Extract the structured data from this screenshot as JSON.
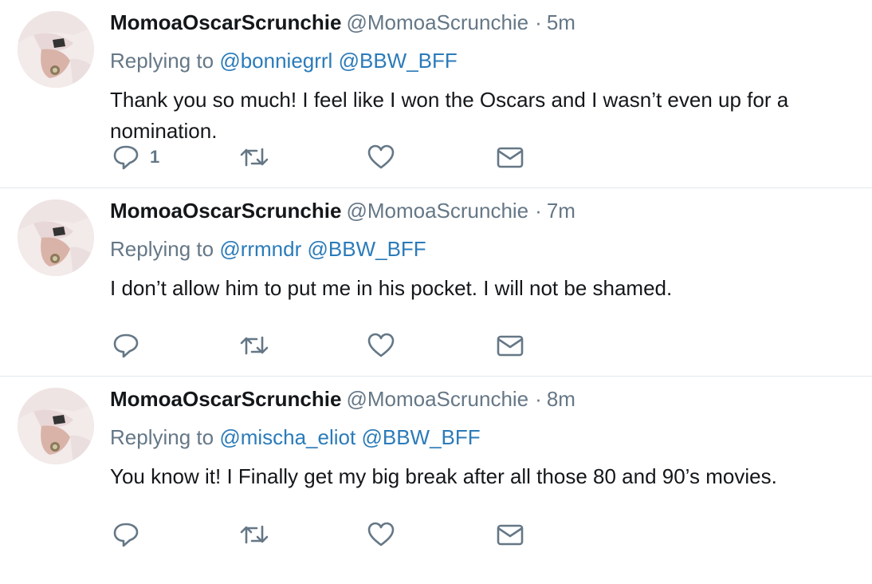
{
  "colors": {
    "link": "#2b7bb9",
    "muted": "#657786",
    "text": "#14171a",
    "divider": "#e1e8ed"
  },
  "tweets": [
    {
      "name": "MomoaOscarScrunchie",
      "handle": "@MomoaScrunchie",
      "separator": "·",
      "time": "5m",
      "replying_prefix": "Replying to",
      "mentions": [
        "@bonniegrrl",
        "@BBW_BFF"
      ],
      "text": "Thank you so much! I feel like I won the Oscars and I wasn’t even up for a nomination.",
      "reply_count": "1",
      "icons": [
        "reply-icon",
        "retweet-icon",
        "like-icon",
        "direct-message-icon"
      ]
    },
    {
      "name": "MomoaOscarScrunchie",
      "handle": "@MomoaScrunchie",
      "separator": "·",
      "time": "7m",
      "replying_prefix": "Replying to",
      "mentions": [
        "@rrmndr",
        "@BBW_BFF"
      ],
      "text": "I don’t allow him to put me in his pocket. I will not be shamed.",
      "reply_count": "",
      "icons": [
        "reply-icon",
        "retweet-icon",
        "like-icon",
        "direct-message-icon"
      ]
    },
    {
      "name": "MomoaOscarScrunchie",
      "handle": "@MomoaScrunchie",
      "separator": "·",
      "time": "8m",
      "replying_prefix": "Replying to",
      "mentions": [
        "@mischa_eliot",
        "@BBW_BFF"
      ],
      "text": "You know it! I Finally get my big break after all those 80 and 90’s movies.",
      "reply_count": "",
      "icons": [
        "reply-icon",
        "retweet-icon",
        "like-icon",
        "direct-message-icon"
      ]
    }
  ]
}
